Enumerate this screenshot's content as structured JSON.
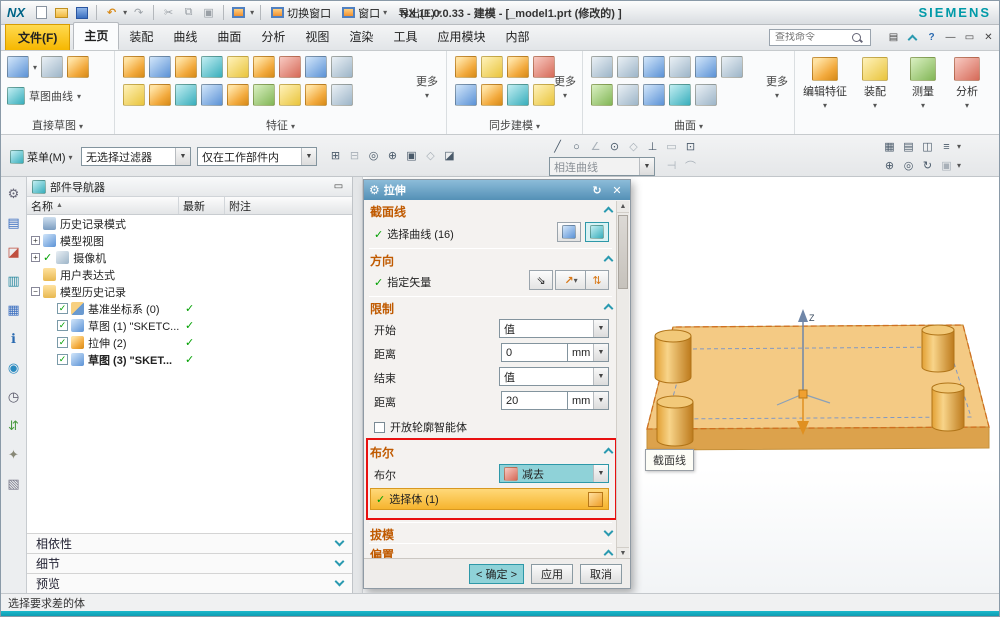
{
  "colors": {
    "accent_teal": "#00aebf",
    "dialog_header": "#5f98bd",
    "section_title": "#c05a00",
    "highlight_orange": "#ffc84d",
    "highlight_teal": "#8fd2d8",
    "red_highlight": "#e81010",
    "brand_teal": "#009aa8",
    "file_tab_yellow": "#f6b700"
  },
  "titlebar": {
    "logo": "NX",
    "switch_window": "切换窗口",
    "window_menu": "窗口",
    "export_menu": "导出(E)",
    "title": "NX 11.0.0.33 - 建模 - [_model1.prt (修改的) ]",
    "brand": "SIEMENS"
  },
  "tabs": {
    "file": "文件(F)",
    "items": [
      "主页",
      "装配",
      "曲线",
      "曲面",
      "分析",
      "视图",
      "渲染",
      "工具",
      "应用模块",
      "内部"
    ],
    "search_placeholder": "查找命令"
  },
  "ribbon": {
    "groups": [
      "直接草图",
      "特征",
      "同步建模",
      "曲面"
    ],
    "buttons": [
      "编辑特征",
      "装配",
      "测量",
      "分析"
    ],
    "more": "更多",
    "sketch_gallery": "草图曲线"
  },
  "seltool": {
    "menu": "菜单(M)",
    "filter": "无选择过滤器",
    "scope": "仅在工作部件内",
    "curve_rule": "相连曲线"
  },
  "navigator": {
    "title": "部件导航器",
    "col_name": "名称",
    "col_status": "最新",
    "col_note": "附注",
    "items": [
      {
        "label": "历史记录模式"
      },
      {
        "label": "模型视图"
      },
      {
        "label": "摄像机"
      },
      {
        "label": "用户表达式"
      },
      {
        "label": "模型历史记录"
      },
      {
        "label": "基准坐标系 (0)",
        "status": "✓"
      },
      {
        "label": "草图 (1) \"SKETC...",
        "status": "✓"
      },
      {
        "label": "拉伸 (2)",
        "status": "✓"
      },
      {
        "label": "草图 (3) \"SKET...",
        "status": "✓"
      }
    ],
    "sections": [
      "相依性",
      "细节",
      "预览"
    ]
  },
  "dialog": {
    "title": "拉伸",
    "section_line": {
      "title": "截面线",
      "select_curve": "选择曲线 (16)"
    },
    "direction": {
      "title": "方向",
      "specify_vector": "指定矢量"
    },
    "limits": {
      "title": "限制",
      "start": "开始",
      "start_option": "值",
      "dist1_label": "距离",
      "dist1": "0",
      "unit1": "mm",
      "end": "结束",
      "end_option": "值",
      "dist2_label": "距离",
      "dist2": "20",
      "unit2": "mm",
      "open_profile": "开放轮廓智能体"
    },
    "boolean": {
      "title": "布尔",
      "label": "布尔",
      "option": "减去",
      "select_body": "选择体 (1)"
    },
    "draft": {
      "title": "拔模"
    },
    "offset": {
      "title": "偏置"
    },
    "ok": "< 确定 >",
    "apply": "应用",
    "cancel": "取消"
  },
  "viewport": {
    "tooltip": "截面线",
    "axis_z": "Z"
  },
  "statusbar": {
    "message": "选择要求差的体"
  }
}
